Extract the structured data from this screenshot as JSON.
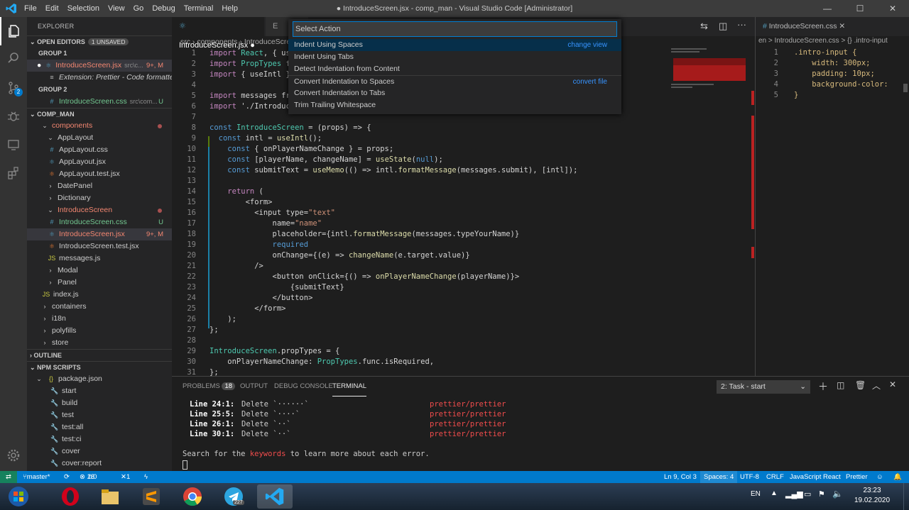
{
  "titlebar": {
    "menu": [
      "File",
      "Edit",
      "Selection",
      "View",
      "Go",
      "Debug",
      "Terminal",
      "Help"
    ],
    "title": "● IntroduceScreen.jsx - comp_man - Visual Studio Code [Administrator]"
  },
  "activity": {
    "scm_badge": "2"
  },
  "sidebar": {
    "title": "EXPLORER",
    "open_editors": "OPEN EDITORS",
    "unsaved": "1 UNSAVED",
    "group1": "GROUP 1",
    "group2": "GROUP 2",
    "open_files": [
      {
        "name": "IntroduceScreen.jsx",
        "desc": "src\\c...",
        "status": "9+, M"
      },
      {
        "name": "Extension: Prettier - Code formatter",
        "desc": "",
        "status": ""
      },
      {
        "name": "IntroduceScreen.css",
        "desc": "src\\com...",
        "status": "U"
      }
    ],
    "project": "COMP_MAN",
    "tree": [
      {
        "name": "components",
        "status": ""
      },
      {
        "name": "AppLayout",
        "status": ""
      },
      {
        "name": "AppLayout.css",
        "status": ""
      },
      {
        "name": "AppLayout.jsx",
        "status": ""
      },
      {
        "name": "AppLayout.test.jsx",
        "status": ""
      },
      {
        "name": "DatePanel",
        "status": ""
      },
      {
        "name": "Dictionary",
        "status": ""
      },
      {
        "name": "IntroduceScreen",
        "status": ""
      },
      {
        "name": "IntroduceScreen.css",
        "status": "U"
      },
      {
        "name": "IntroduceScreen.jsx",
        "status": "9+, M"
      },
      {
        "name": "IntroduceScreen.test.jsx",
        "status": ""
      },
      {
        "name": "messages.js",
        "status": ""
      },
      {
        "name": "Modal",
        "status": ""
      },
      {
        "name": "Panel",
        "status": ""
      },
      {
        "name": "index.js",
        "status": ""
      },
      {
        "name": "containers",
        "status": ""
      },
      {
        "name": "i18n",
        "status": ""
      },
      {
        "name": "polyfills",
        "status": ""
      },
      {
        "name": "store",
        "status": ""
      }
    ],
    "outline": "OUTLINE",
    "npm": "NPM SCRIPTS",
    "package": "package.json",
    "scripts": [
      "start",
      "build",
      "test",
      "test:all",
      "test:ci",
      "cover",
      "cover:report"
    ]
  },
  "tabs": {
    "active": "IntroduceScreen.jsx",
    "second": "E"
  },
  "breadcrumb": {
    "a": "src",
    "b": "components",
    "c": "IntroduceScre"
  },
  "palette": {
    "placeholder": "Select Action",
    "items": [
      {
        "label": "Indent Using Spaces",
        "hint": "change view"
      },
      {
        "label": "Indent Using Tabs",
        "hint": ""
      },
      {
        "label": "Detect Indentation from Content",
        "hint": ""
      },
      {
        "label": "Convert Indentation to Spaces",
        "hint": "convert file"
      },
      {
        "label": "Convert Indentation to Tabs",
        "hint": ""
      },
      {
        "label": "Trim Trailing Whitespace",
        "hint": ""
      }
    ]
  },
  "code_lines": [
    {
      "n": "1",
      "t": "import React, { use"
    },
    {
      "n": "2",
      "t": "import PropTypes fr"
    },
    {
      "n": "3",
      "t": "import { useIntl }"
    },
    {
      "n": "4",
      "t": ""
    },
    {
      "n": "5",
      "t": "import messages fro"
    },
    {
      "n": "6",
      "t": "import './Introduc"
    },
    {
      "n": "7",
      "t": ""
    },
    {
      "n": "8",
      "t": "const IntroduceScreen = (props) => {"
    },
    {
      "n": "9",
      "t": "  const intl = useIntl();"
    },
    {
      "n": "10",
      "t": "    const { onPlayerNameChange } = props;"
    },
    {
      "n": "11",
      "t": "    const [playerName, changeName] = useState(null);"
    },
    {
      "n": "12",
      "t": "    const submitText = useMemo(() => intl.formatMessage(messages.submit), [intl]);"
    },
    {
      "n": "13",
      "t": ""
    },
    {
      "n": "14",
      "t": "    return ("
    },
    {
      "n": "15",
      "t": "        <form>"
    },
    {
      "n": "16",
      "t": "          <input type=\"text\""
    },
    {
      "n": "17",
      "t": "              name=\"name\""
    },
    {
      "n": "18",
      "t": "              placeholder={intl.formatMessage(messages.typeYourName)}"
    },
    {
      "n": "19",
      "t": "              required"
    },
    {
      "n": "20",
      "t": "              onChange={(e) => changeName(e.target.value)}"
    },
    {
      "n": "21",
      "t": "          />"
    },
    {
      "n": "22",
      "t": "              <button onClick={() => onPlayerNameChange(playerName)}>"
    },
    {
      "n": "23",
      "t": "                  {submitText}"
    },
    {
      "n": "24",
      "t": "              </button>"
    },
    {
      "n": "25",
      "t": "          </form>"
    },
    {
      "n": "26",
      "t": "    );"
    },
    {
      "n": "27",
      "t": "};"
    },
    {
      "n": "28",
      "t": ""
    },
    {
      "n": "29",
      "t": "IntroduceScreen.propTypes = {"
    },
    {
      "n": "30",
      "t": "    onPlayerNameChange: PropTypes.func.isRequired,"
    },
    {
      "n": "31",
      "t": "};"
    }
  ],
  "right_editor": {
    "tab": "IntroduceScreen.css",
    "crumb": "en > IntroduceScreen.css > {} .intro-input",
    "lines": [
      {
        "n": "1",
        "t": ".intro-input {"
      },
      {
        "n": "2",
        "t": "    width: 300px;"
      },
      {
        "n": "3",
        "t": "    padding: 10px;"
      },
      {
        "n": "4",
        "t": "    background-color:"
      },
      {
        "n": "5",
        "t": "}"
      }
    ]
  },
  "panel": {
    "tabs": [
      "PROBLEMS",
      "OUTPUT",
      "DEBUG CONSOLE",
      "TERMINAL"
    ],
    "problems_count": "18",
    "task": "2: Task - start",
    "lines": [
      {
        "a": "Line 24:1:",
        "b": "Delete `······`",
        "c": "prettier/prettier"
      },
      {
        "a": "Line 25:5:",
        "b": "Delete `····`",
        "c": "prettier/prettier"
      },
      {
        "a": "Line 26:1:",
        "b": "Delete `··`",
        "c": "prettier/prettier"
      },
      {
        "a": "Line 30:1:",
        "b": "Delete `··`",
        "c": "prettier/prettier"
      }
    ],
    "search_a": "Search for the ",
    "search_kw": "keywords",
    "search_b": " to learn more about each error."
  },
  "status": {
    "branch": "master*",
    "errors": "18",
    "warnings": "0",
    "x1": "1",
    "pos": "Ln 9, Col 3",
    "spaces": "Spaces: 4",
    "enc": "UTF-8",
    "eol": "CRLF",
    "lang": "JavaScript React",
    "fmt": "Prettier"
  },
  "taskbar": {
    "lang": "EN",
    "time": "23:23",
    "date": "19.02.2020",
    "telegram_badge": "227"
  }
}
